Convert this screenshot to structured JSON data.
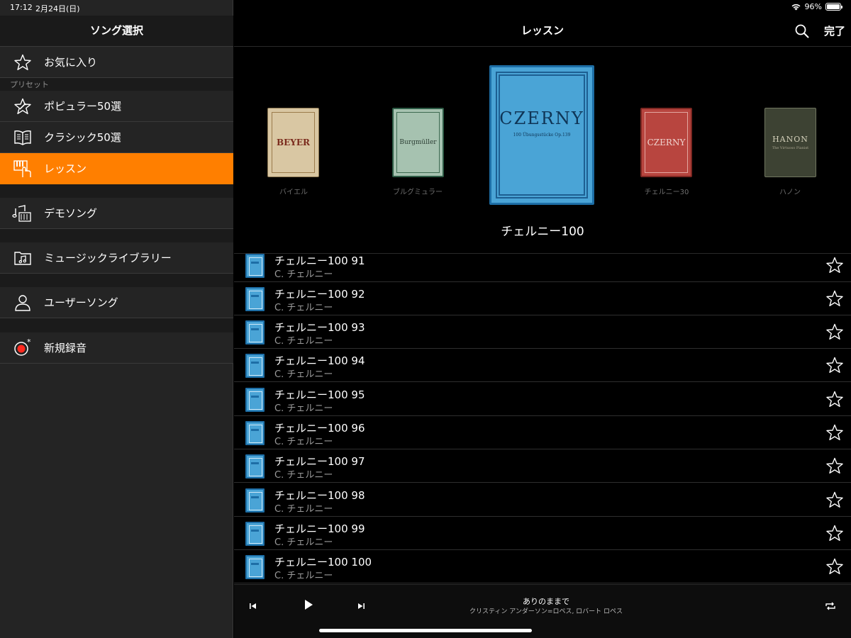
{
  "status": {
    "time": "17:12",
    "date": "2月24日(日)",
    "battery": "96%"
  },
  "sidebar": {
    "title": "ソング選択",
    "favorites": {
      "label": "お気に入り",
      "icon": "star-outline-icon"
    },
    "preset_label": "プリセット",
    "items": [
      {
        "label": "ポピュラー50選",
        "icon": "star-pen-icon"
      },
      {
        "label": "クラシック50選",
        "icon": "book-icon"
      },
      {
        "label": "レッスン",
        "icon": "piano-hand-icon",
        "active": true
      }
    ],
    "demo": {
      "label": "デモソング",
      "icon": "music-notes-icon"
    },
    "library": {
      "label": "ミュージックライブラリー",
      "icon": "music-folder-icon"
    },
    "user": {
      "label": "ユーザーソング",
      "icon": "person-icon"
    },
    "record": {
      "label": "新規録音",
      "icon": "record-icon"
    }
  },
  "header": {
    "title": "レッスン",
    "done_label": "完了"
  },
  "carousel": {
    "books": [
      {
        "cover_title": "BEYER",
        "caption": "バイエル",
        "color": "#d9c7a3"
      },
      {
        "cover_title": "Burgmüller",
        "caption": "ブルグミュラー",
        "color": "#a6c2b0"
      },
      {
        "cover_title": "CZERNY",
        "cover_subtitle": "100 Übungsstücke Op.139",
        "caption": "",
        "color": "#4aa4d6"
      },
      {
        "cover_title": "CZERNY",
        "caption": "チェルニー30",
        "color": "#b8453f"
      },
      {
        "cover_title": "HANON",
        "cover_subtitle": "The Virtuoso Pianist",
        "caption": "ハノン",
        "color": "#3d4233"
      }
    ],
    "selected_title": "チェルニー100"
  },
  "songs": [
    {
      "title": "チェルニー100 91",
      "composer": "C. チェルニー"
    },
    {
      "title": "チェルニー100 92",
      "composer": "C. チェルニー"
    },
    {
      "title": "チェルニー100 93",
      "composer": "C. チェルニー"
    },
    {
      "title": "チェルニー100 94",
      "composer": "C. チェルニー"
    },
    {
      "title": "チェルニー100 95",
      "composer": "C. チェルニー"
    },
    {
      "title": "チェルニー100 96",
      "composer": "C. チェルニー"
    },
    {
      "title": "チェルニー100 97",
      "composer": "C. チェルニー"
    },
    {
      "title": "チェルニー100 98",
      "composer": "C. チェルニー"
    },
    {
      "title": "チェルニー100 99",
      "composer": "C. チェルニー"
    },
    {
      "title": "チェルニー100 100",
      "composer": "C. チェルニー"
    }
  ],
  "player": {
    "title": "ありのままで",
    "artist": "クリスティン アンダーソン=ロペス, ロバート ロペス"
  },
  "colors": {
    "accent": "#ff7f00"
  }
}
